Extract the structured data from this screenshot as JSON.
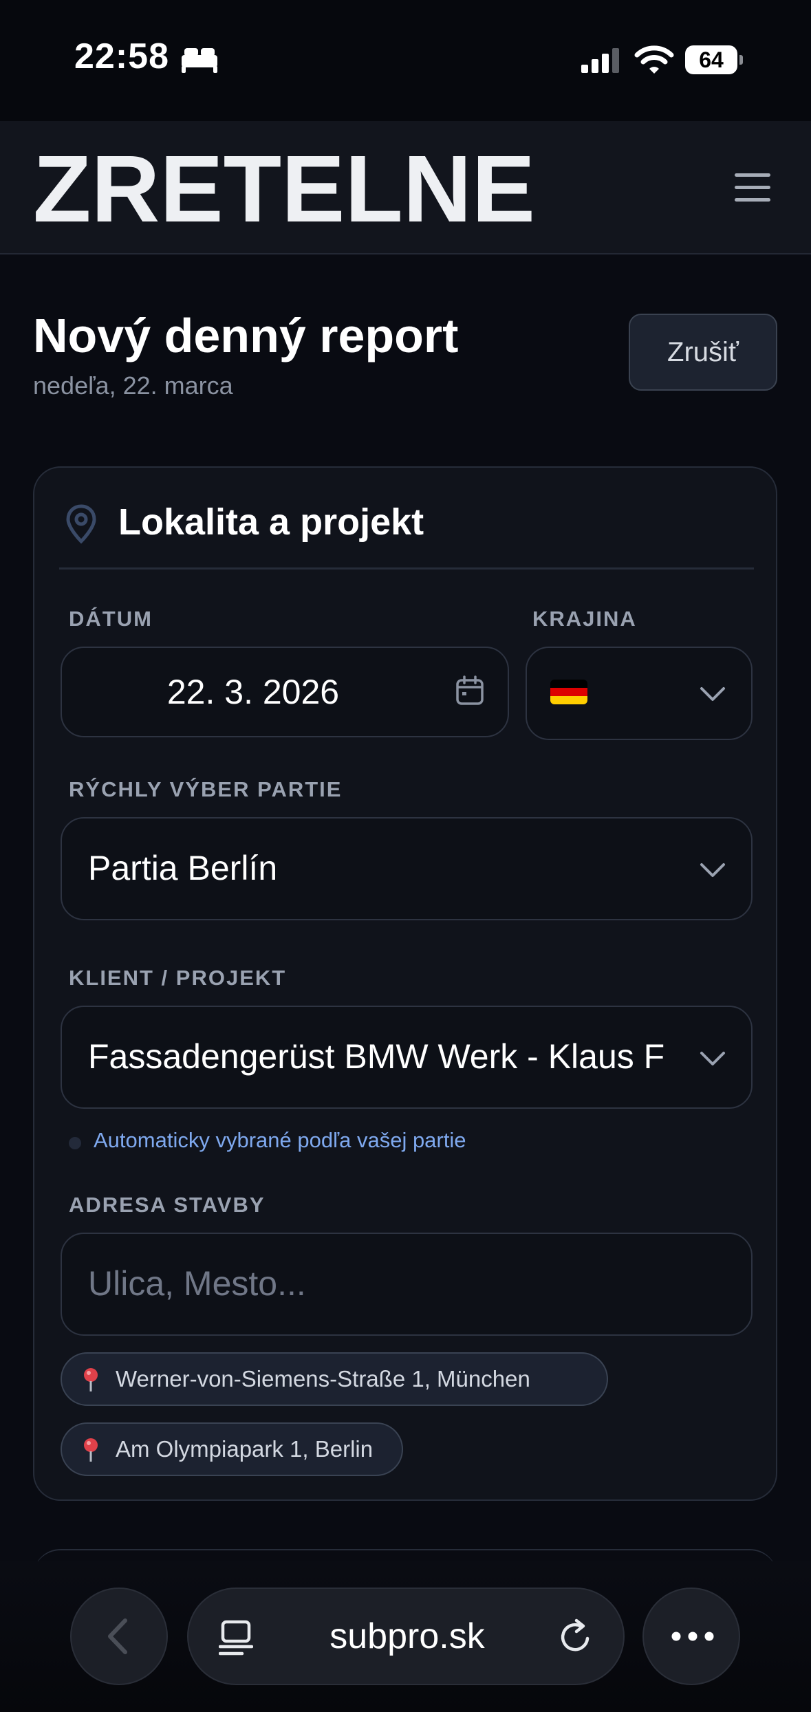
{
  "status_bar": {
    "time": "22:58",
    "battery_level": "64",
    "icons": [
      "bed-icon",
      "signal-icon",
      "wifi-icon",
      "battery-icon"
    ]
  },
  "header": {
    "logo_text": "ZRETELNE",
    "menu_icon": "hamburger-menu-icon"
  },
  "page": {
    "title": "Nový denný report",
    "subtitle": "nedeľa, 22. marca",
    "cancel_label": "Zrušiť"
  },
  "section": {
    "title": "Lokalita a projekt",
    "icon": "location-pin-icon"
  },
  "form": {
    "date_label": "DÁTUM",
    "date_value": "22. 3. 2026",
    "country_label": "KRAJINA",
    "country_flag": "germany-flag",
    "crew_label": "RÝCHLY VÝBER PARTIE",
    "crew_value": "Partia Berlín",
    "client_label": "KLIENT / PROJEKT",
    "client_value": "Fassadengerüst BMW Werk - Klaus F",
    "client_hint": "Automaticky vybrané podľa vašej partie",
    "address_label": "ADRESA STAVBY",
    "address_value": "",
    "address_placeholder": "Ulica, Mesto...",
    "address_suggestions": [
      "Werner-von-Siemens-Straße 1, München",
      "Am Olympiapark 1, Berlin"
    ]
  },
  "browser": {
    "url": "subpro.sk",
    "icons": [
      "back-icon",
      "reader-icon",
      "reload-icon",
      "more-icon"
    ]
  },
  "colors": {
    "background": "#090b12",
    "card": "#10131b",
    "hint_text": "#7fa9ef",
    "flag_black": "#000000",
    "flag_red": "#dd0000",
    "flag_gold": "#ffce00"
  }
}
